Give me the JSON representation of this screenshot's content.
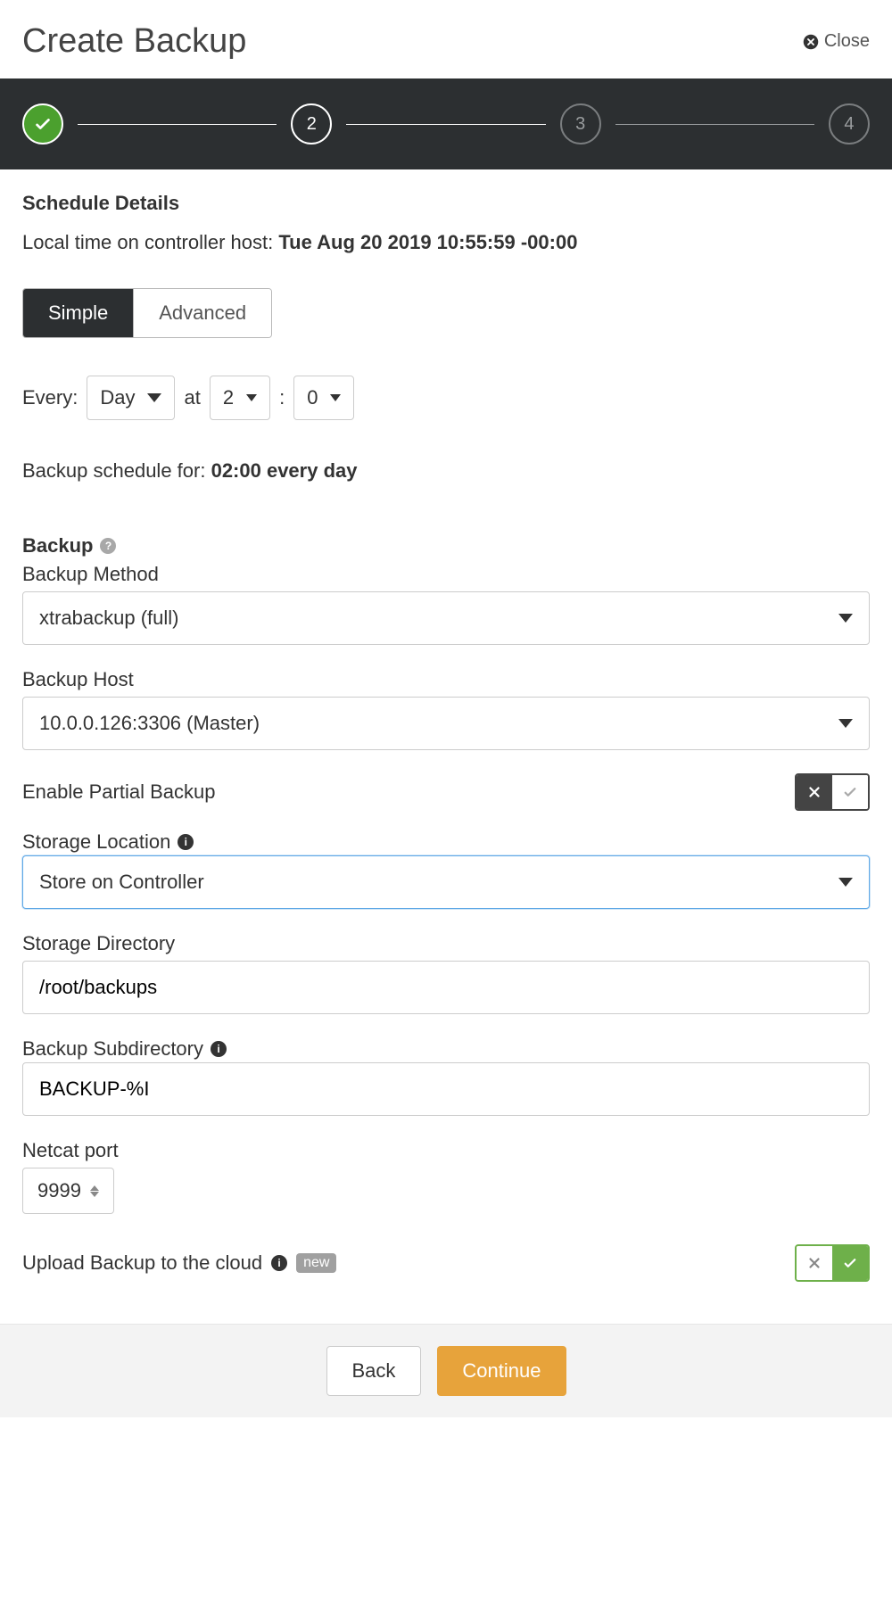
{
  "header": {
    "title": "Create Backup",
    "close": "Close"
  },
  "stepper": {
    "step2": "2",
    "step3": "3",
    "step4": "4"
  },
  "schedule": {
    "title": "Schedule Details",
    "localtime_label": "Local time on controller host: ",
    "localtime_value": "Tue Aug 20 2019 10:55:59 -00:00",
    "tabs": {
      "simple": "Simple",
      "advanced": "Advanced"
    },
    "every_label": "Every:",
    "every_value": "Day",
    "at_label": "at",
    "hour": "2",
    "colon": ":",
    "minute": "0",
    "summary_label": "Backup schedule for: ",
    "summary_value": "02:00 every day"
  },
  "backup": {
    "title": "Backup",
    "method_label": "Backup Method",
    "method_value": "xtrabackup (full)",
    "host_label": "Backup Host",
    "host_value": "10.0.0.126:3306 (Master)",
    "partial_label": "Enable Partial Backup",
    "storage_location_label": "Storage Location",
    "storage_location_value": "Store on Controller",
    "storage_dir_label": "Storage Directory",
    "storage_dir_value": "/root/backups",
    "subdir_label": "Backup Subdirectory",
    "subdir_value": "BACKUP-%I",
    "netcat_label": "Netcat port",
    "netcat_value": "9999",
    "upload_label": "Upload Backup to the cloud",
    "upload_badge": "new"
  },
  "footer": {
    "back": "Back",
    "continue": "Continue"
  }
}
